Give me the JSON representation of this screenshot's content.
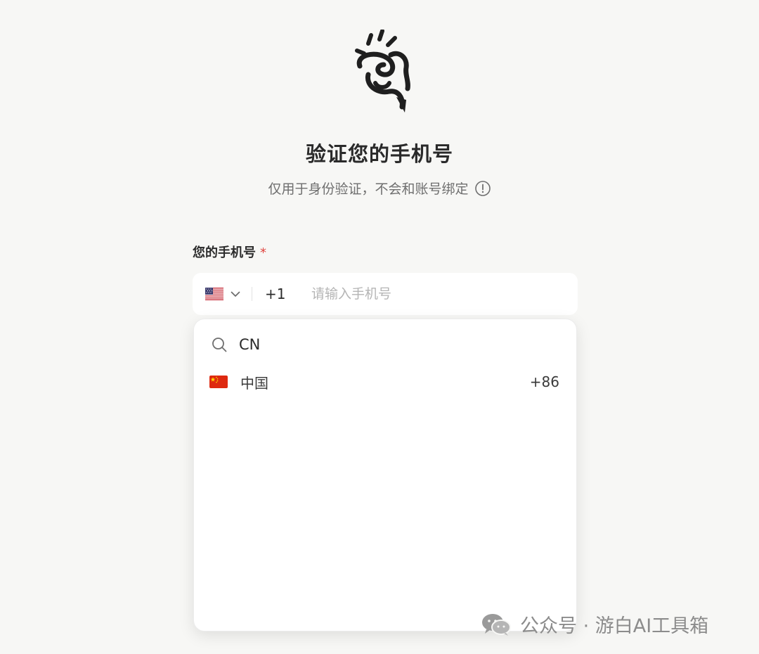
{
  "header": {
    "title": "验证您的手机号",
    "subtitle": "仅用于身份验证，不会和账号绑定"
  },
  "phone_field": {
    "label": "您的手机号",
    "required_mark": "*",
    "selected_country_flag": "us-flag-icon",
    "dial_code": "+1",
    "placeholder": "请输入手机号",
    "value": ""
  },
  "country_dropdown": {
    "search_value": "CN",
    "options": [
      {
        "flag": "cn-flag-icon",
        "name": "中国",
        "code": "+86"
      }
    ]
  },
  "footer": {
    "links": [
      "",
      ""
    ]
  },
  "watermark": {
    "text": "公众号 · 游白AI工具箱",
    "icon": "wechat-icon"
  },
  "colors": {
    "background": "#f7f7f5",
    "required": "#e0443e",
    "text_primary": "#2b2b2b",
    "text_muted": "#6f6f6f"
  }
}
